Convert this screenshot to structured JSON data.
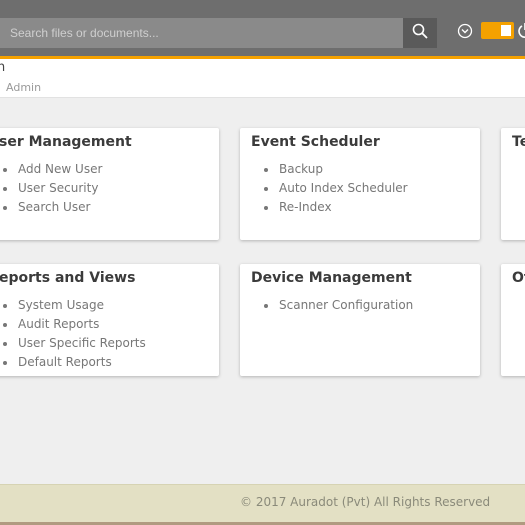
{
  "search": {
    "placeholder": "Search files or documents..."
  },
  "header": {
    "title": "n",
    "breadcrumb": "Admin"
  },
  "colors": {
    "accent": "#f4a100",
    "topbar": "#6e6e6e",
    "footer": "#e3e0c4"
  },
  "icons": {
    "search": "search-icon",
    "dropdown": "circle-chevron-down-icon",
    "toggle": "toggle-switch",
    "power": "power-icon"
  },
  "cards": [
    {
      "title": "ser Management",
      "items": [
        "Add New User",
        "User Security",
        "Search User"
      ]
    },
    {
      "title": "Event Scheduler",
      "items": [
        "Backup",
        "Auto Index Scheduler",
        "Re-Index"
      ]
    },
    {
      "title": "Te",
      "items": []
    },
    {
      "title": "eports and Views",
      "items": [
        "System Usage",
        "Audit Reports",
        "User Specific Reports",
        "Default Reports"
      ]
    },
    {
      "title": "Device Management",
      "items": [
        "Scanner Configuration"
      ]
    },
    {
      "title": "Ot",
      "items": []
    }
  ],
  "footer": {
    "text": "© 2017 Auradot (Pvt) All Rights Reserved"
  }
}
